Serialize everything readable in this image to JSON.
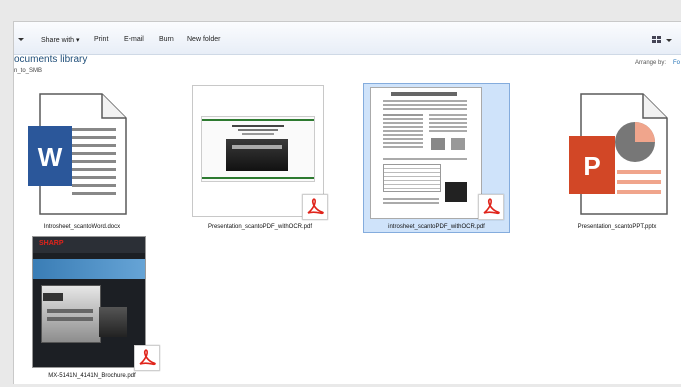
{
  "toolbar": {
    "share_with": "Share with ▾",
    "print": "Print",
    "email": "E-mail",
    "burn": "Burn",
    "new_folder": "New folder"
  },
  "library": {
    "title": "ocuments library",
    "subtitle": "n_to_SMB",
    "arrange_label": "Arrange by:",
    "arrange_value": "Fo"
  },
  "files": [
    {
      "name": "Introsheet_scantoWord.docx",
      "type": "word"
    },
    {
      "name": "Presentation_scantoPDF_withOCR.pdf",
      "type": "pdf"
    },
    {
      "name": "introsheet_scantoPDF_withOCR.pdf",
      "type": "pdf",
      "selected": true
    },
    {
      "name": "Presentation_scantoPPT.pptx",
      "type": "pptx"
    },
    {
      "name": "MX-5141N_4141N_Brochure.pdf",
      "type": "pdf"
    }
  ],
  "thumbnail_text": {
    "word_letter": "W",
    "ppt_letter": "P",
    "brand": "SHARP"
  },
  "colors": {
    "word": "#2b579a",
    "powerpoint": "#d24726",
    "pdf": "#e0241b",
    "selection": "#cfe3fa",
    "library_title": "#1f4e79"
  }
}
